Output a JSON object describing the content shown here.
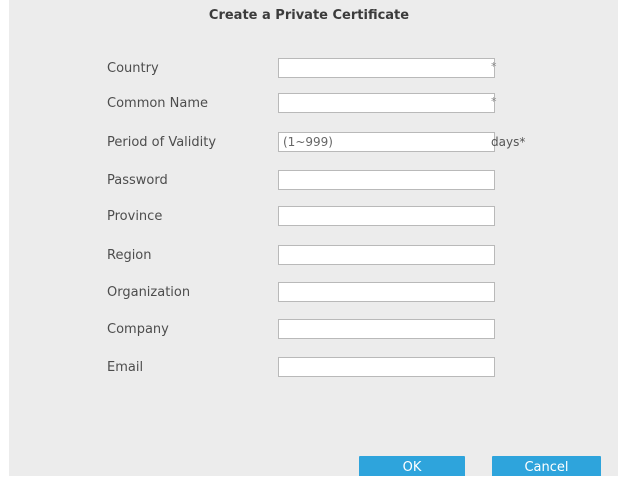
{
  "dialog": {
    "title": "Create a Private Certificate"
  },
  "fields": [
    {
      "label": "Country",
      "value": "",
      "placeholder": "",
      "suffix": "*"
    },
    {
      "label": "Common Name",
      "value": "",
      "placeholder": "",
      "suffix": "*"
    },
    {
      "label": "Period of Validity",
      "value": "",
      "placeholder": "(1~999)",
      "suffix": "days*"
    },
    {
      "label": "Password",
      "value": "",
      "placeholder": "",
      "suffix": ""
    },
    {
      "label": "Province",
      "value": "",
      "placeholder": "",
      "suffix": ""
    },
    {
      "label": "Region",
      "value": "",
      "placeholder": "",
      "suffix": ""
    },
    {
      "label": "Organization",
      "value": "",
      "placeholder": "",
      "suffix": ""
    },
    {
      "label": "Company",
      "value": "",
      "placeholder": "",
      "suffix": ""
    },
    {
      "label": "Email",
      "value": "",
      "placeholder": "",
      "suffix": ""
    }
  ],
  "buttons": {
    "ok": "OK",
    "cancel": "Cancel"
  },
  "colors": {
    "accent": "#2ea4dc",
    "dialog_bg": "#ececec"
  }
}
